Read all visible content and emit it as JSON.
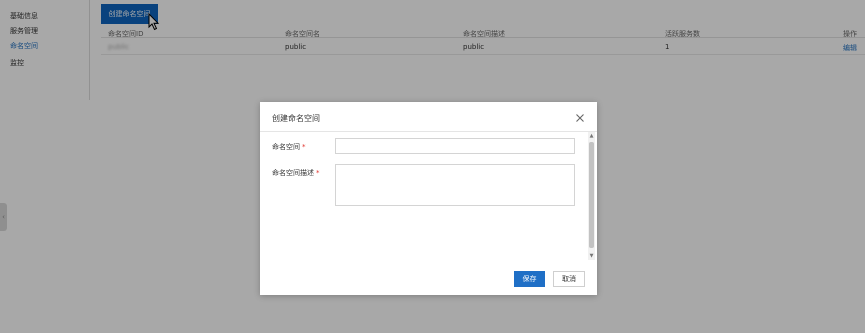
{
  "sidebar": {
    "items": [
      {
        "label": "基础信息"
      },
      {
        "label": "服务管理"
      },
      {
        "label": "命名空间"
      },
      {
        "label": "监控"
      }
    ],
    "collapse_glyph": "‹"
  },
  "toolbar": {
    "create_label": "创建命名空间"
  },
  "table": {
    "columns": [
      "命名空间ID",
      "命名空间名",
      "命名空间描述",
      "活跃服务数",
      "操作"
    ],
    "rows": [
      {
        "id": "public",
        "name": "public",
        "description": "public",
        "active_services": "1",
        "action": "编辑"
      }
    ]
  },
  "dialog": {
    "title": "创建命名空间",
    "close_glyph": "✕",
    "fields": {
      "namespace": {
        "label": "命名空间",
        "required_mark": "*",
        "value": "",
        "placeholder": ""
      },
      "description": {
        "label": "命名空间描述",
        "required_mark": "*",
        "value": "",
        "placeholder": ""
      }
    },
    "save_label": "保存",
    "cancel_label": "取消",
    "scroll_up_glyph": "▲",
    "scroll_down_glyph": "▼"
  },
  "colors": {
    "primary": "#1f6fc6",
    "create_button": "#0e64bf",
    "required": "#e0312a",
    "link": "#1f6fbf"
  }
}
